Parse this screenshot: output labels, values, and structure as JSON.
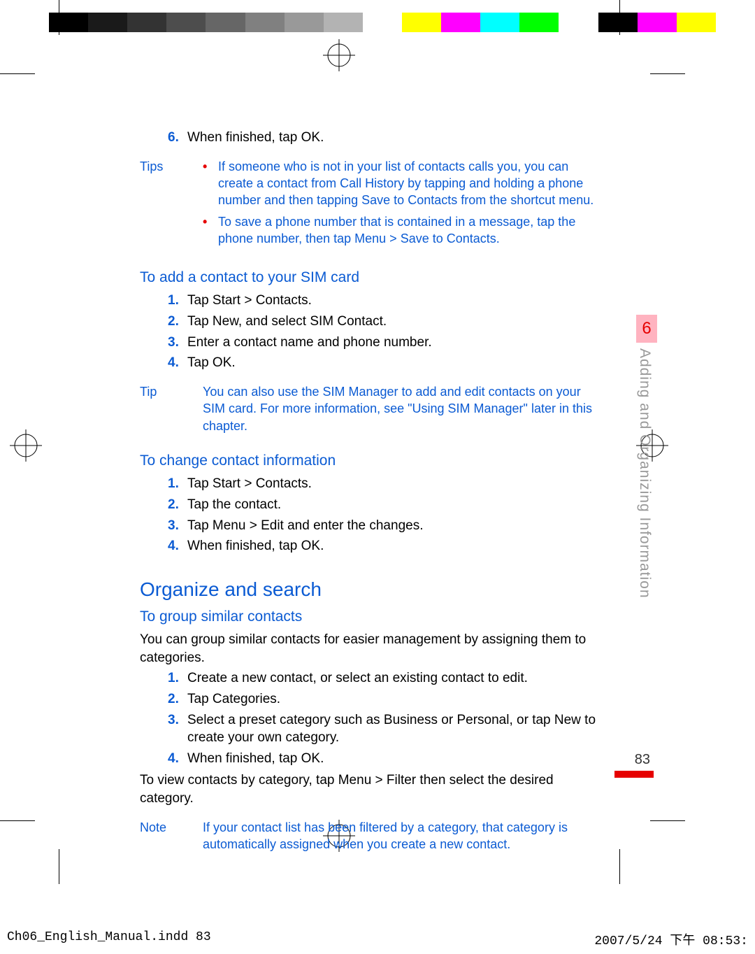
{
  "colorbar": [
    "#000",
    "#1a1a1a",
    "#333",
    "#4d4d4d",
    "#666",
    "#808080",
    "#999",
    "#b3b3b3",
    "#ffffff",
    "#ffff00",
    "#ff00ff",
    "#00ffff",
    "#00ff00",
    "#ffffff",
    "#000000",
    "#ff00ff",
    "#ffff00",
    "#ffffff"
  ],
  "step6": {
    "num": "6.",
    "text": "When finished, tap OK."
  },
  "tips_label": "Tips",
  "tips": [
    "If someone who is not in your list of contacts calls you, you can create a contact from Call History by tapping and holding a phone number and then tapping Save to Contacts from the shortcut menu.",
    "To save a phone number that is contained in a message, tap the phone number, then tap Menu > Save to Contacts."
  ],
  "sub1": "To add a contact to your SIM card",
  "list1": [
    {
      "num": "1.",
      "text": "Tap Start > Contacts."
    },
    {
      "num": "2.",
      "text": "Tap New, and select SIM Contact."
    },
    {
      "num": "3.",
      "text": "Enter a contact name and phone number."
    },
    {
      "num": "4.",
      "text": "Tap OK."
    }
  ],
  "tip_label": "Tip",
  "tip_text": "You can also use the SIM Manager to add and edit contacts on your SIM card. For more information, see \"Using SIM Manager\" later in this chapter.",
  "sub2": "To change contact information",
  "list2": [
    {
      "num": "1.",
      "text": "Tap Start > Contacts."
    },
    {
      "num": "2.",
      "text": "Tap the contact."
    },
    {
      "num": "3.",
      "text": "Tap Menu > Edit and enter the changes."
    },
    {
      "num": "4.",
      "text": "When finished, tap OK."
    }
  ],
  "section": "Organize and search",
  "sub3": "To group similar contacts",
  "body3": "You can group similar contacts for easier management by assigning them to categories.",
  "list3": [
    {
      "num": "1.",
      "text": "Create a new contact, or select an existing contact to edit."
    },
    {
      "num": "2.",
      "text": "Tap Categories."
    },
    {
      "num": "3.",
      "text": "Select a preset category such as Business or Personal, or tap New to create your own category."
    },
    {
      "num": "4.",
      "text": "When finished, tap OK."
    }
  ],
  "body3b": "To view contacts by category, tap Menu > Filter then select the desired category.",
  "note_label": "Note",
  "note_text": "If your contact list has been filtered by a category, that category is automatically assigned when you create a new contact.",
  "chapter_num": "6",
  "chapter_title": "Adding and Organizing Information",
  "page_num": "83",
  "footer_left": "Ch06_English_Manual.indd   83",
  "footer_right": "2007/5/24   下午 08:53:"
}
